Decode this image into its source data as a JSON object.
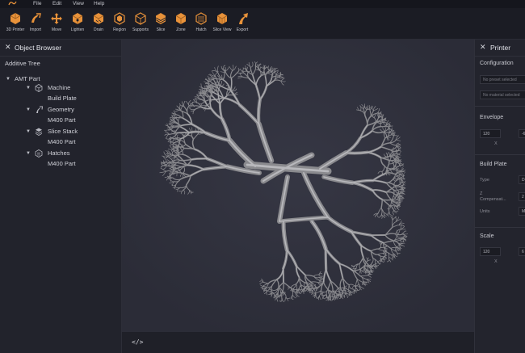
{
  "menu": [
    "File",
    "Edit",
    "View",
    "Help"
  ],
  "toolbar": [
    {
      "label": "3D Printer",
      "icon": "printer-cube-icon"
    },
    {
      "label": "Import",
      "icon": "import-icon"
    },
    {
      "label": "Move",
      "icon": "move-icon"
    },
    {
      "label": "Lighten",
      "icon": "lighten-icon"
    },
    {
      "label": "Drain",
      "icon": "drain-icon"
    },
    {
      "label": "Region",
      "icon": "region-icon"
    },
    {
      "label": "Supports",
      "icon": "supports-icon"
    },
    {
      "label": "Slice",
      "icon": "slice-icon"
    },
    {
      "label": "Zone",
      "icon": "zone-icon"
    },
    {
      "label": "Hatch",
      "icon": "hatch-icon"
    },
    {
      "label": "Slice View",
      "icon": "slice-view-icon"
    },
    {
      "label": "Export",
      "icon": "export-icon"
    }
  ],
  "object_browser": {
    "title": "Object Browser",
    "section": "Additive Tree",
    "root": "AMT Part",
    "items": [
      {
        "name": "Machine",
        "sub": "Build Plate"
      },
      {
        "name": "Geometry",
        "sub": "M400  Part"
      },
      {
        "name": "Slice Stack",
        "sub": "M400  Part"
      },
      {
        "name": "Hatches",
        "sub": "M400 Part"
      }
    ]
  },
  "printer_panel": {
    "title": "Printer",
    "configuration": {
      "label": "Configuration",
      "preset_placeholder": "No preset selected",
      "material_placeholder": "No material selected"
    },
    "envelope": {
      "label": "Envelope",
      "x_value": "120",
      "y_value": "-6",
      "x_label": "X"
    },
    "build_plate": {
      "label": "Build Plate",
      "type_label": "Type",
      "type_value": "D",
      "z_label": "Z",
      "comp_label": "Compensat...",
      "comp_value": "2",
      "units_label": "Units",
      "units_value": "M"
    },
    "scale": {
      "label": "Scale",
      "x_value": "120",
      "y_value": "6",
      "x_label": "X"
    }
  },
  "viewport_footer": {
    "code_icon": "</>"
  },
  "colors": {
    "accent": "#e8923a",
    "background": "#1c1d26",
    "viewport": "#2e2f3a",
    "model": "#8a8a8e"
  }
}
